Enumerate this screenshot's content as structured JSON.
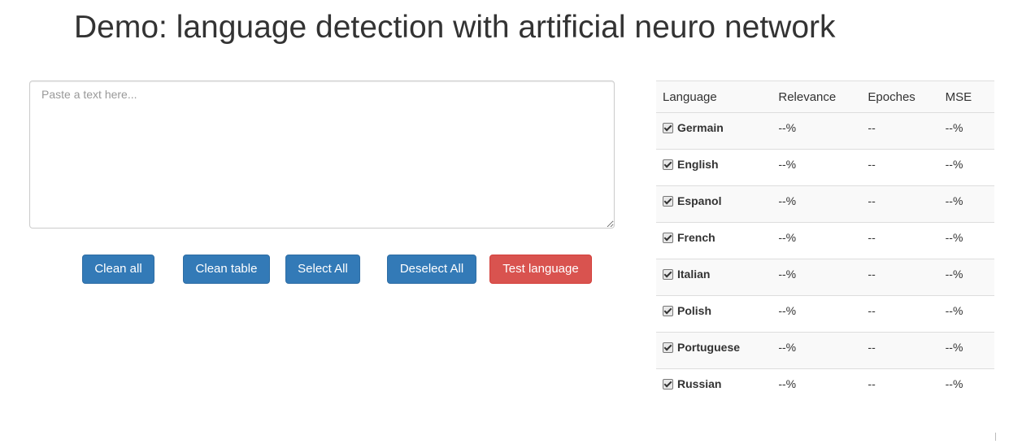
{
  "title": "Demo: language detection with artificial neuro network",
  "input": {
    "placeholder": "Paste a text here...",
    "value": ""
  },
  "buttons": {
    "clean_all": "Clean all",
    "clean_table": "Clean table",
    "select_all": "Select All",
    "deselect_all": "Deselect All",
    "test_language": "Test language"
  },
  "colors": {
    "primary": "#337ab7",
    "danger": "#d9534f"
  },
  "table": {
    "headers": [
      "Language",
      "Relevance",
      "Epoches",
      "MSE"
    ],
    "rows": [
      {
        "language": "Germain",
        "checked": true,
        "relevance": "--%",
        "epoches": "--",
        "mse": "--%"
      },
      {
        "language": "English",
        "checked": true,
        "relevance": "--%",
        "epoches": "--",
        "mse": "--%"
      },
      {
        "language": "Espanol",
        "checked": true,
        "relevance": "--%",
        "epoches": "--",
        "mse": "--%"
      },
      {
        "language": "French",
        "checked": true,
        "relevance": "--%",
        "epoches": "--",
        "mse": "--%"
      },
      {
        "language": "Italian",
        "checked": true,
        "relevance": "--%",
        "epoches": "--",
        "mse": "--%"
      },
      {
        "language": "Polish",
        "checked": true,
        "relevance": "--%",
        "epoches": "--",
        "mse": "--%"
      },
      {
        "language": "Portuguese",
        "checked": true,
        "relevance": "--%",
        "epoches": "--",
        "mse": "--%"
      },
      {
        "language": "Russian",
        "checked": true,
        "relevance": "--%",
        "epoches": "--",
        "mse": "--%"
      }
    ]
  }
}
